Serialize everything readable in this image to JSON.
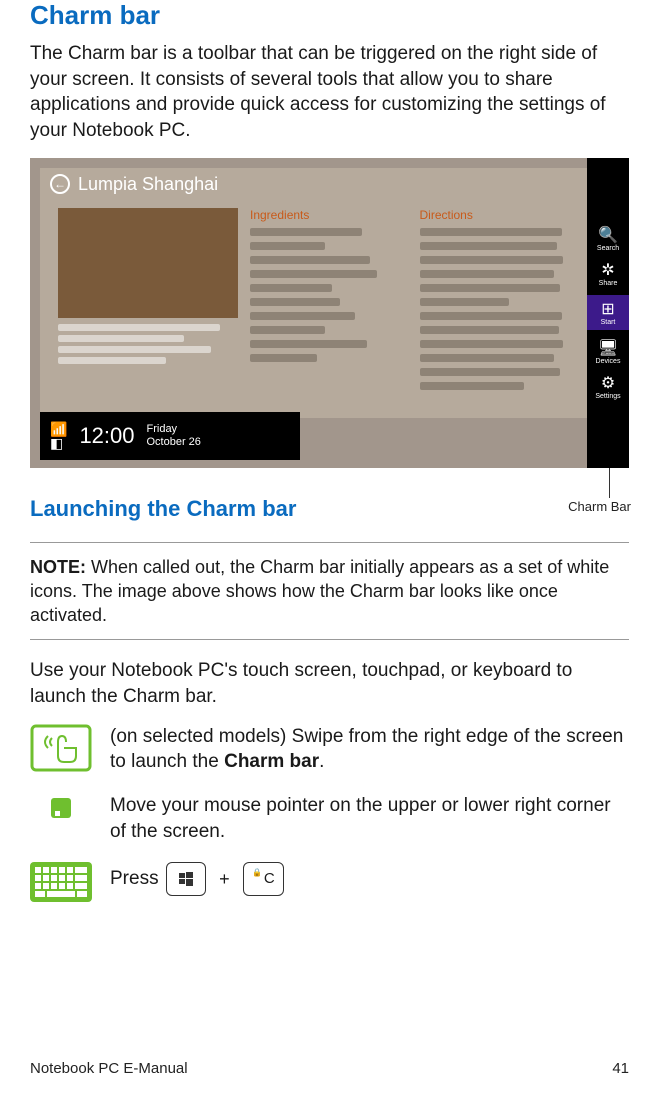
{
  "heading": "Charm bar",
  "intro": "The Charm bar is a toolbar that can be triggered on the right side of your screen. It consists of several tools that allow you to share applications and provide quick access for customizing the settings of your Notebook PC.",
  "screenshot": {
    "app_title": "Lumpia Shanghai",
    "col1_label": "Ingredients",
    "col2_label": "Directions",
    "clock_time": "12:00",
    "clock_day": "Friday",
    "clock_date": "October 26",
    "charms": [
      {
        "label": "Search"
      },
      {
        "label": "Share"
      },
      {
        "label": "Start"
      },
      {
        "label": "Devices"
      },
      {
        "label": "Settings"
      }
    ]
  },
  "callout": "Charm Bar",
  "sub_heading": "Launching the Charm bar",
  "note_prefix": "NOTE:",
  "note_body": " When called out, the Charm bar initially appears as a set of white icons. The image above shows how the Charm bar looks like once activated.",
  "use_text": "Use your Notebook PC's touch screen, touchpad, or keyboard to launch the Charm bar.",
  "instr1_a": "(on selected models) Swipe from the right edge of the screen to launch the ",
  "instr1_b": "Charm bar",
  "instr1_c": ".",
  "instr2": "Move your mouse pointer on the upper or lower right corner of the screen.",
  "instr3_prefix": "Press ",
  "key2_label": "C",
  "footer_left": "Notebook PC E-Manual",
  "footer_right": "41"
}
